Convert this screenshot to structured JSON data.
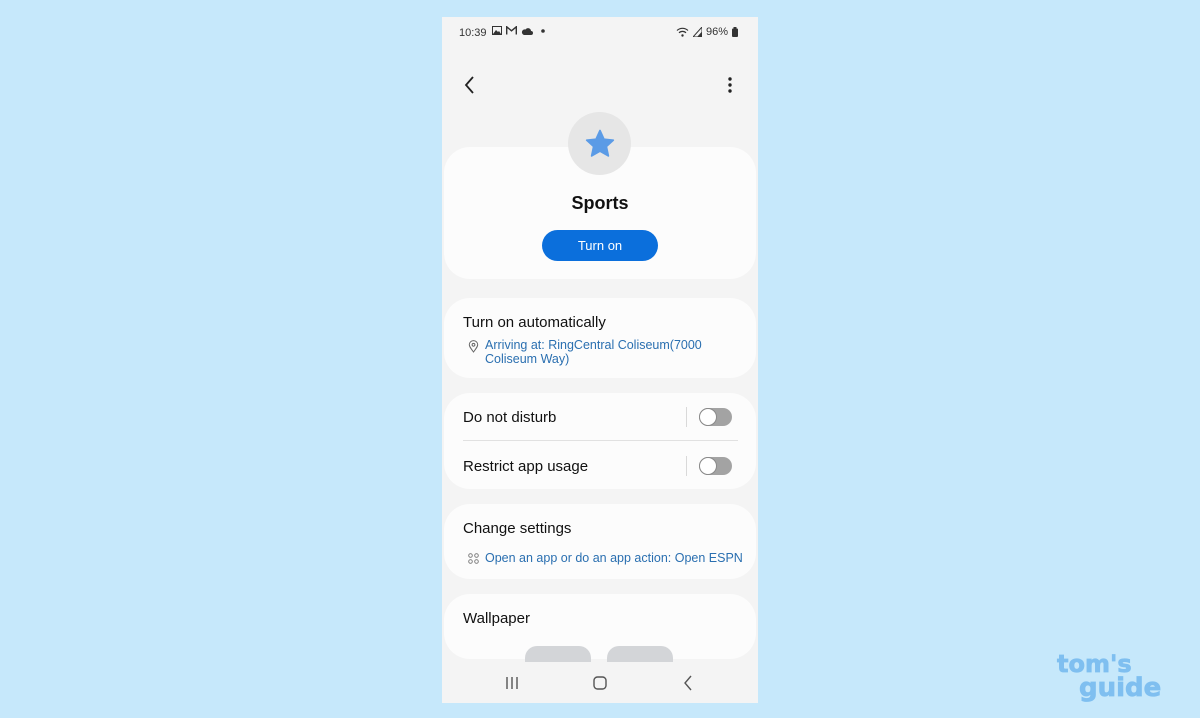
{
  "status_bar": {
    "time": "10:39",
    "battery": "96%",
    "notification_icons": [
      "gallery-icon",
      "gmail-icon",
      "cloud-icon",
      "dot-icon"
    ],
    "system_icons": [
      "wifi-icon",
      "signal-icon",
      "battery-icon"
    ]
  },
  "app_bar": {
    "back_icon": "chevron-left-icon",
    "more_icon": "more-vertical-icon"
  },
  "mode": {
    "icon": "star-icon",
    "name": "Sports",
    "turn_on_label": "Turn on"
  },
  "auto_section": {
    "title": "Turn on automatically",
    "condition_line1": "Arriving at: RingCentral Coliseum(7000",
    "condition_line2": "Coliseum Way)"
  },
  "toggles": [
    {
      "label": "Do not disturb",
      "on": false
    },
    {
      "label": "Restrict app usage",
      "on": false
    }
  ],
  "change_settings": {
    "title": "Change settings",
    "action": "Open an app or do an app action: Open ESPN"
  },
  "wallpaper": {
    "title": "Wallpaper"
  },
  "colors": {
    "accent": "#0b6fdc",
    "link": "#2a6fb0",
    "background": "#c6e8fb",
    "star": "#5b9be6"
  },
  "watermark": {
    "line1": "tom's",
    "line2": "guide"
  }
}
